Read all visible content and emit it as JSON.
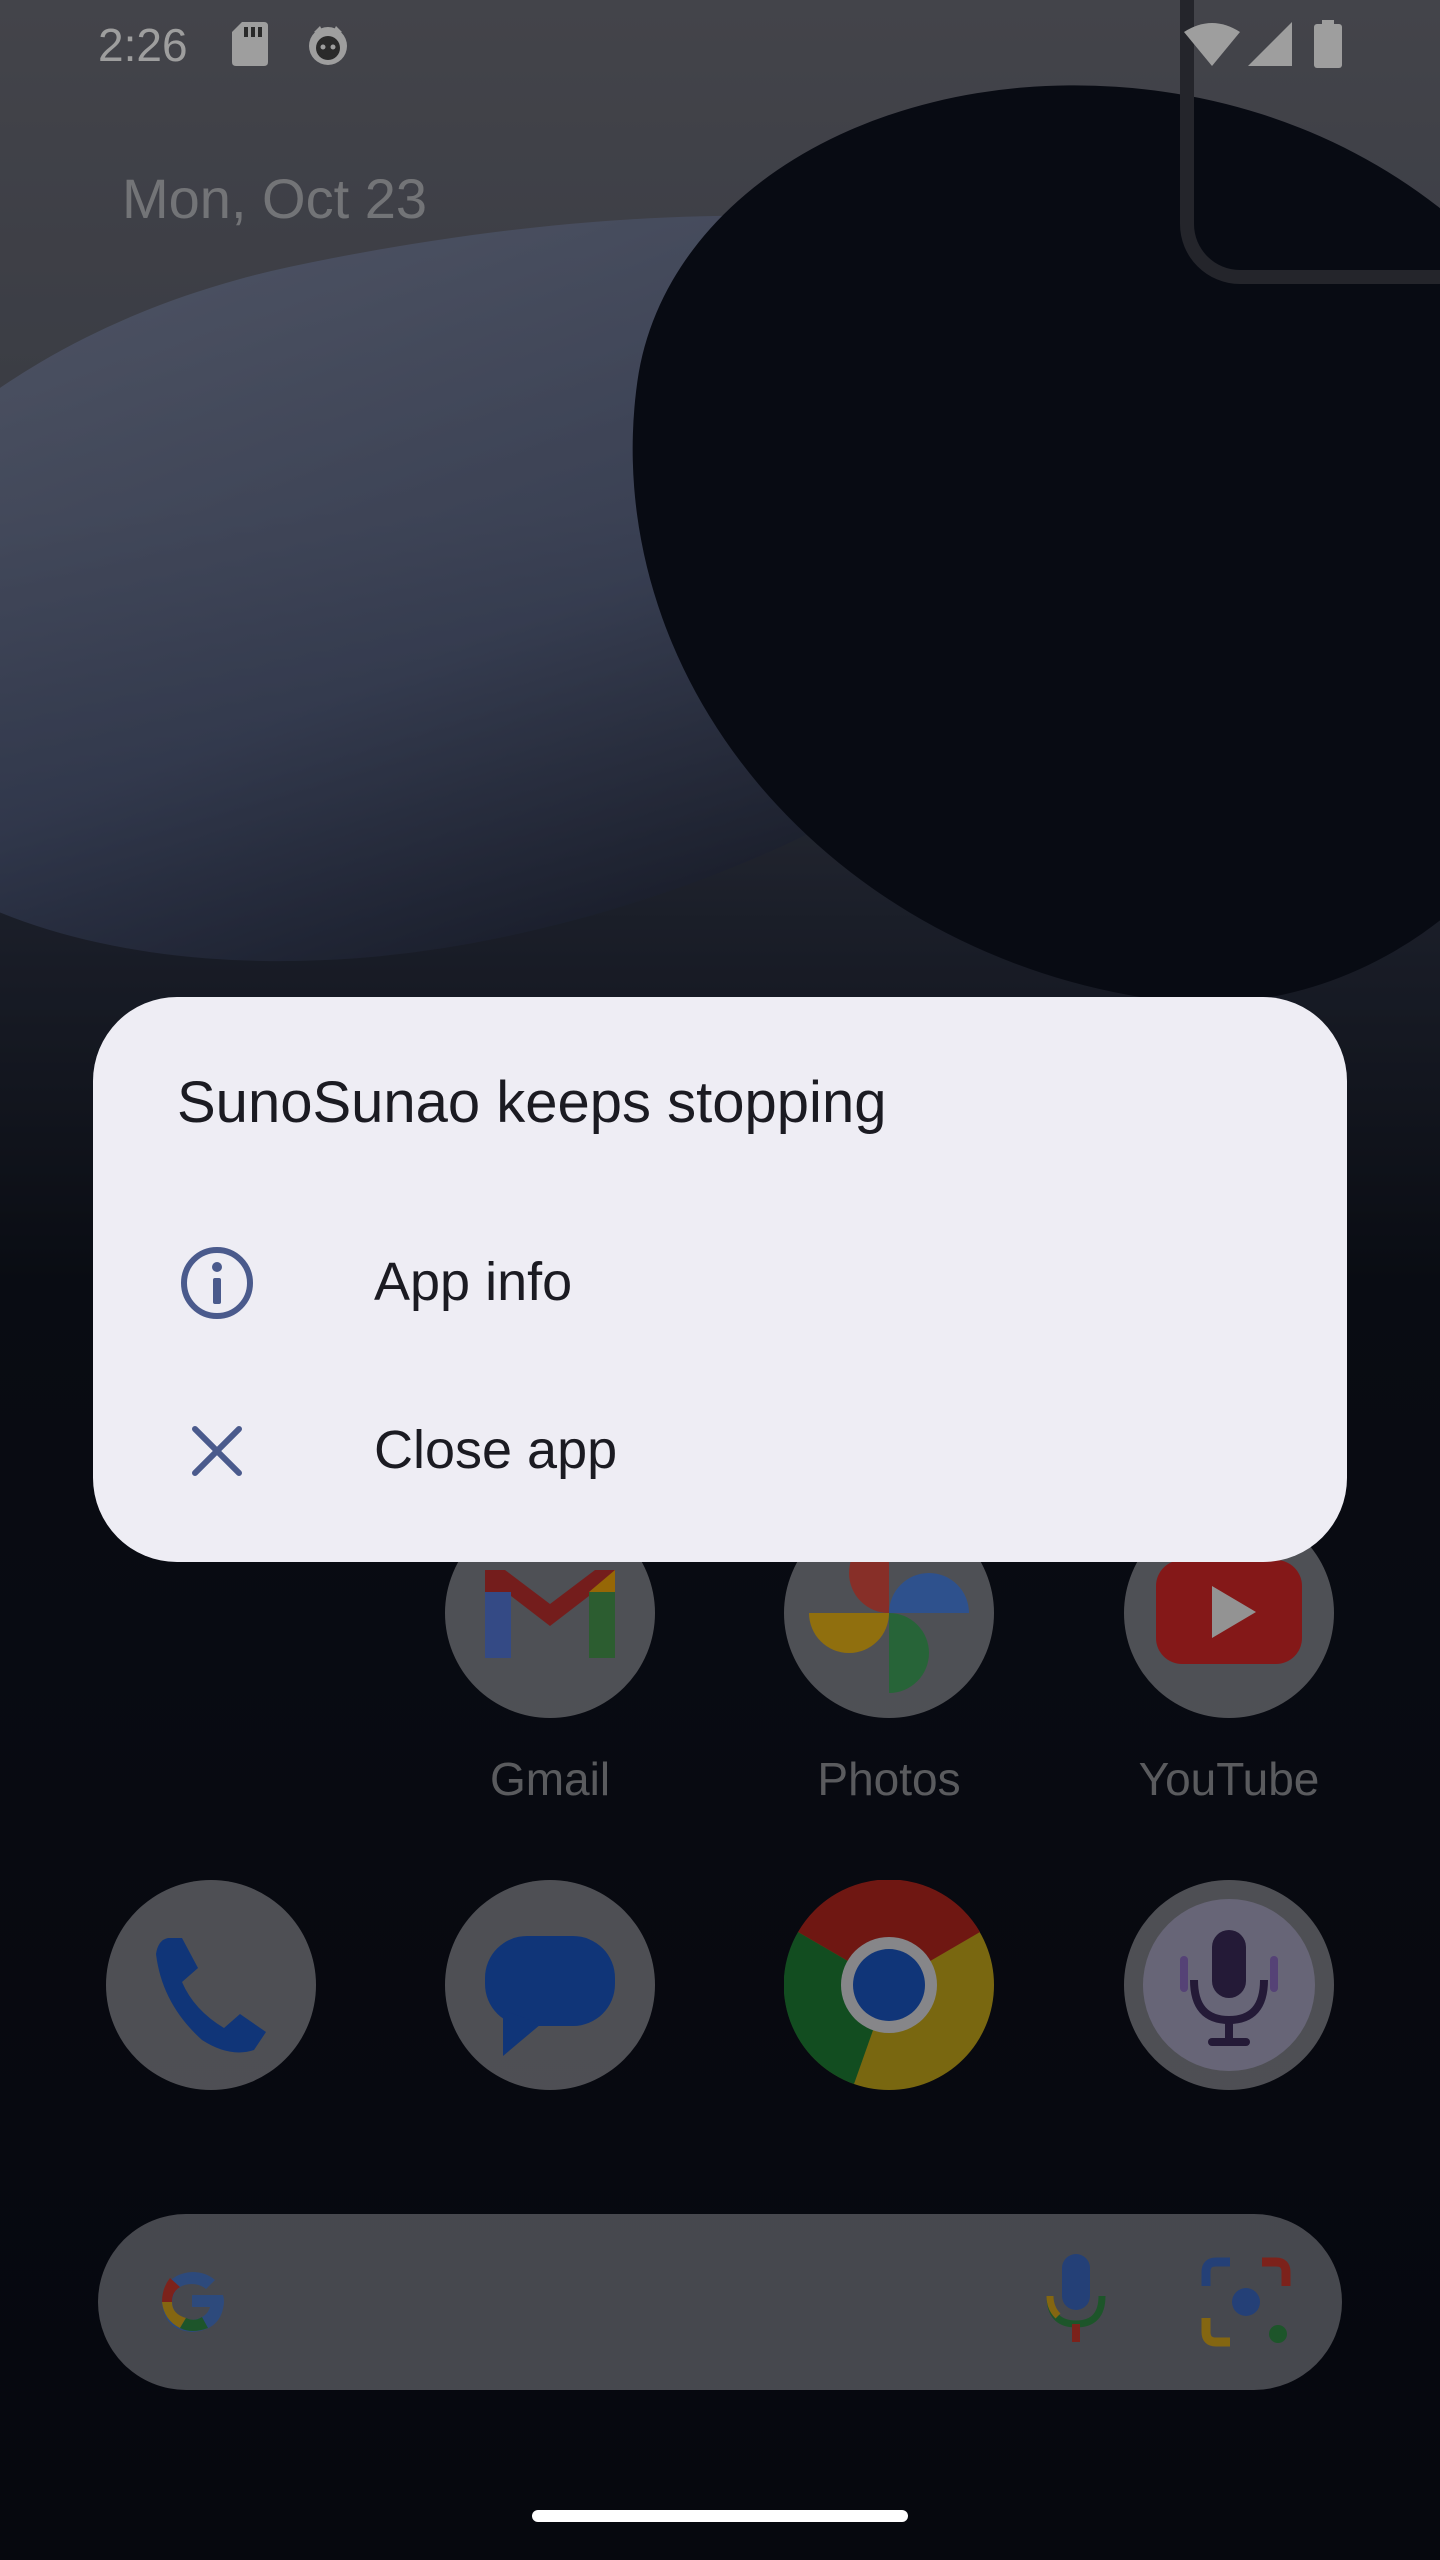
{
  "status_bar": {
    "time": "2:26",
    "icons": [
      "sd-card-icon",
      "cat-icon",
      "wifi-icon",
      "signal-icon",
      "battery-icon"
    ]
  },
  "home": {
    "date": "Mon, Oct 23",
    "apps_row1": [
      {
        "label": "Gmail",
        "icon": "gmail-icon"
      },
      {
        "label": "Photos",
        "icon": "photos-icon"
      },
      {
        "label": "YouTube",
        "icon": "youtube-icon"
      }
    ],
    "apps_row2": [
      {
        "icon": "phone-icon"
      },
      {
        "icon": "messages-icon"
      },
      {
        "icon": "chrome-icon"
      },
      {
        "icon": "recorder-icon"
      }
    ],
    "search_bar": {
      "icons": [
        "google-g-icon",
        "mic-icon",
        "lens-icon"
      ]
    }
  },
  "dialog": {
    "title": "SunoSunao keeps stopping",
    "app_info_label": "App info",
    "close_app_label": "Close app"
  },
  "colors": {
    "dialog_bg": "#eeedf4",
    "icon_accent": "#4a5a8c"
  }
}
